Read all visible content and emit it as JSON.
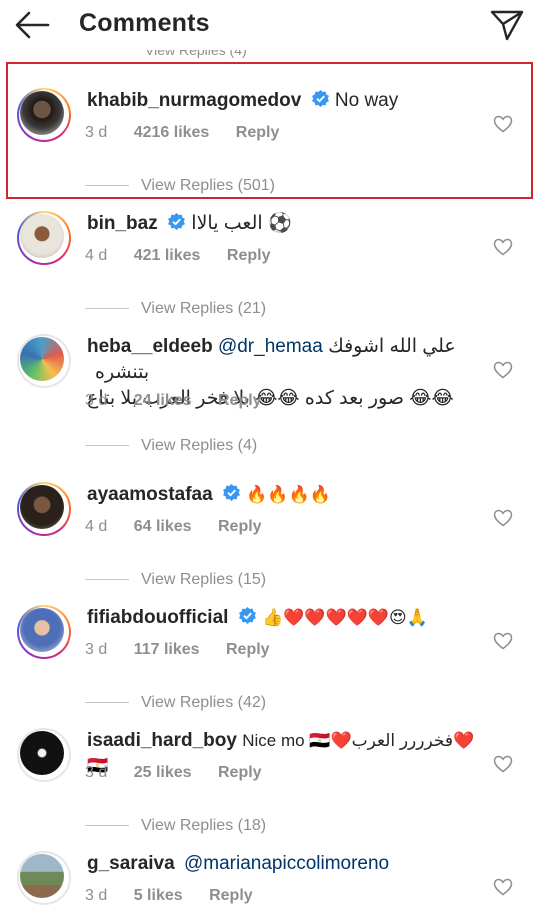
{
  "header": {
    "title": "Comments",
    "back_icon": "arrow-left-icon",
    "send_icon": "paper-plane-icon"
  },
  "peek_text": "View Replies (4)",
  "comments": [
    {
      "username": "khabib_nurmagomedov",
      "verified": true,
      "text": "No way",
      "age": "3 d",
      "likes": "4216 likes",
      "reply": "Reply",
      "replies": "View Replies (501)",
      "highlighted": true
    },
    {
      "username": "bin_baz",
      "verified": true,
      "text": "العب يالاا ⚽",
      "age": "4 d",
      "likes": "421 likes",
      "reply": "Reply",
      "replies": "View Replies (21)"
    },
    {
      "username": "heba__eldeeb",
      "verified": false,
      "mention": "@dr_hemaa",
      "text": "علي الله اشوفك بتنشره",
      "text2": "😂😂 صور بعد كده 😂😂 بلا فخر العرب بلا بتاع",
      "age": "3 d",
      "likes": "24 likes",
      "reply": "Reply",
      "replies": "View Replies (4)"
    },
    {
      "username": "ayaamostafaa",
      "verified": true,
      "text": "🔥🔥🔥🔥",
      "age": "4 d",
      "likes": "64 likes",
      "reply": "Reply",
      "replies": "View Replies (15)"
    },
    {
      "username": "fifiabdouofficial",
      "verified": true,
      "text": "👍❤️❤️❤️❤️❤️😍🙏",
      "age": "3 d",
      "likes": "117 likes",
      "reply": "Reply",
      "replies": "View Replies (42)"
    },
    {
      "username": "isaadi_hard_boy",
      "verified": false,
      "text": "Nice mo 🇪🇬❤️فخرررر العرب❤️🇪🇬",
      "age": "3 d",
      "likes": "25 likes",
      "reply": "Reply",
      "replies": "View Replies (18)"
    },
    {
      "username": "g_saraiva",
      "verified": false,
      "mention": "@marianapiccolimoreno",
      "text": "",
      "age": "3 d",
      "likes": "5 likes",
      "reply": "Reply"
    }
  ]
}
